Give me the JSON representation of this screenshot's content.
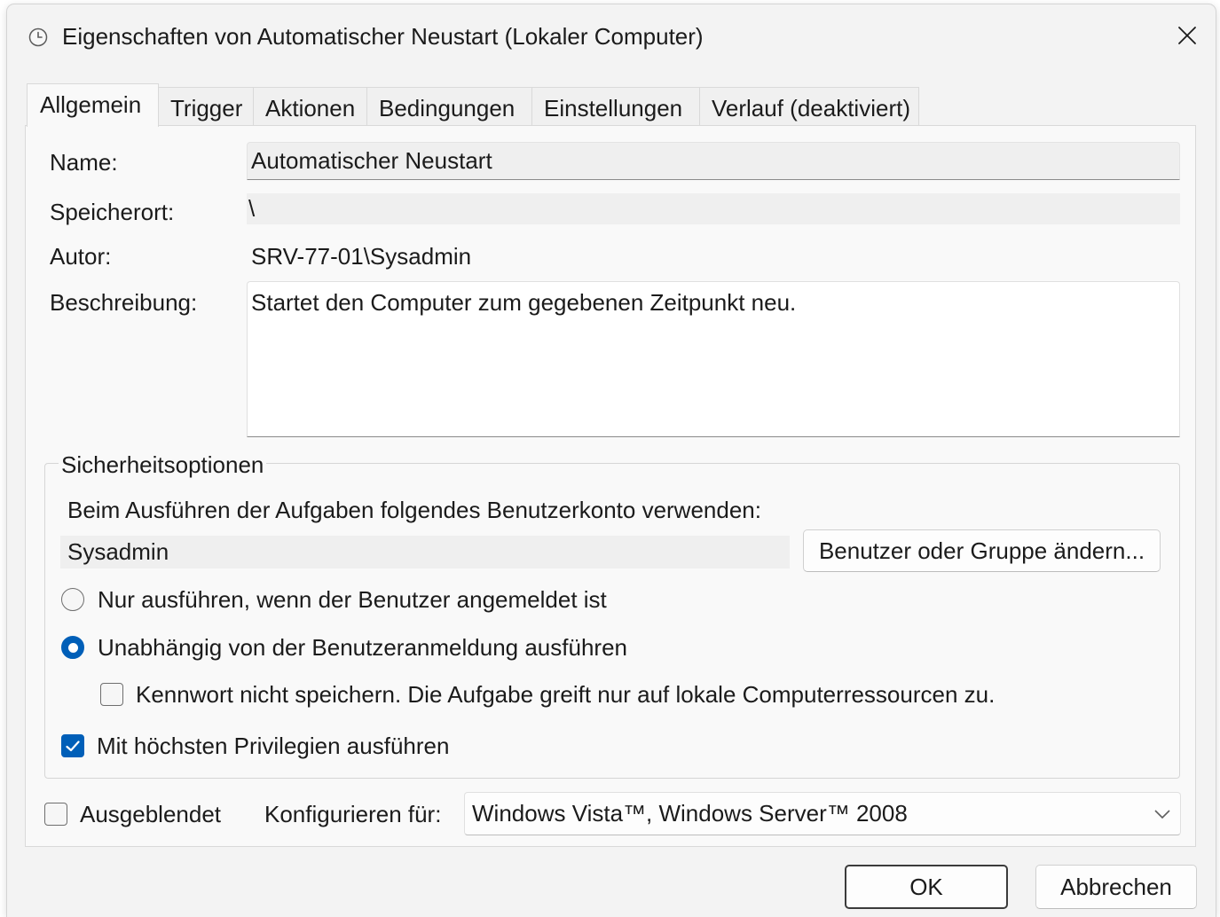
{
  "window": {
    "title": "Eigenschaften von Automatischer Neustart (Lokaler Computer)"
  },
  "icons": {
    "title": "task-scheduler-clock-icon",
    "close": "close-icon",
    "dropdown": "chevron-down-icon",
    "checked": "checkmark-icon"
  },
  "tabs": [
    {
      "label": "Allgemein",
      "selected": true
    },
    {
      "label": "Trigger",
      "selected": false
    },
    {
      "label": "Aktionen",
      "selected": false
    },
    {
      "label": "Bedingungen",
      "selected": false
    },
    {
      "label": "Einstellungen",
      "selected": false
    },
    {
      "label": "Verlauf (deaktiviert)",
      "selected": false
    }
  ],
  "general": {
    "name": {
      "label": "Name:",
      "value": "Automatischer Neustart"
    },
    "location": {
      "label": "Speicherort:",
      "value": "\\"
    },
    "author": {
      "label": "Autor:",
      "value": "SRV-77-01\\Sysadmin"
    },
    "description": {
      "label": "Beschreibung:",
      "value": "Startet den Computer zum gegebenen Zeitpunkt neu."
    }
  },
  "security": {
    "title": "Sicherheitsoptionen",
    "account_prompt": "Beim Ausführen der Aufgaben folgendes Benutzerkonto verwenden:",
    "account": "Sysadmin",
    "change_account_button": "Benutzer oder Gruppe ändern...",
    "run_only_when_logged_on": {
      "label": "Nur ausführen, wenn der Benutzer angemeldet ist",
      "selected": false
    },
    "run_whether_logged_on_or_not": {
      "label": "Unabhängig von der Benutzeranmeldung ausführen",
      "selected": true
    },
    "do_not_store_password": {
      "label": "Kennwort nicht speichern. Die Aufgabe greift nur auf lokale Computerressourcen zu.",
      "checked": false
    },
    "run_with_highest_privileges": {
      "label": "Mit höchsten Privilegien ausführen",
      "checked": true
    }
  },
  "hidden": {
    "label": "Ausgeblendet",
    "checked": false
  },
  "configure_for": {
    "label": "Konfigurieren für:",
    "selected": "Windows Vista™, Windows Server™ 2008"
  },
  "buttons": {
    "ok": "OK",
    "cancel": "Abbrechen"
  },
  "colors": {
    "accent": "#005fb8",
    "text": "#1b1b1b"
  }
}
